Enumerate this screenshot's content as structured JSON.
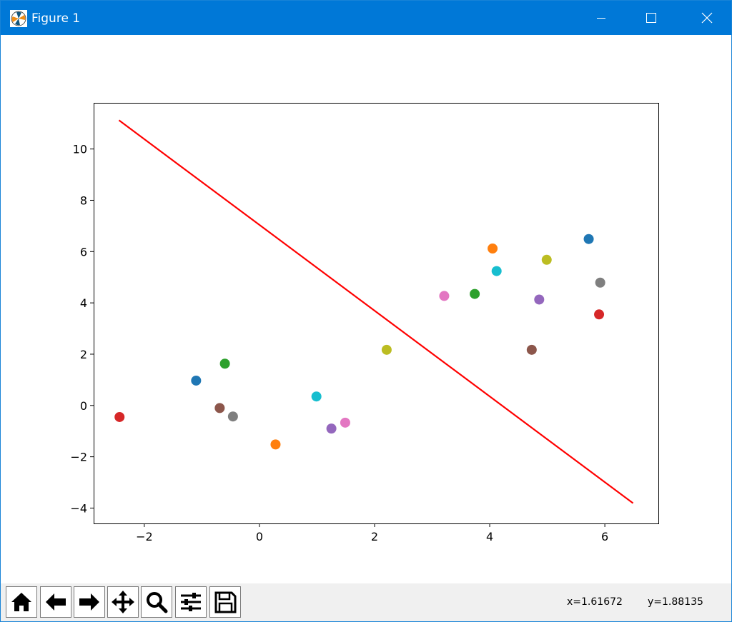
{
  "window": {
    "title": "Figure 1"
  },
  "colors": {
    "titlebar": "#0078d7",
    "line": "#ff0000",
    "toolbar": "#f0f0f0"
  },
  "toolbar": {
    "buttons": [
      {
        "name": "home-icon"
      },
      {
        "name": "back-arrow-icon"
      },
      {
        "name": "forward-arrow-icon"
      },
      {
        "name": "pan-icon"
      },
      {
        "name": "zoom-icon"
      },
      {
        "name": "configure-subplots-icon"
      },
      {
        "name": "save-icon"
      }
    ],
    "x_readout": "x=1.61672",
    "y_readout": "y=1.88135"
  },
  "chart_data": {
    "type": "scatter",
    "title": "",
    "xlabel": "",
    "ylabel": "",
    "xlim": [
      -2.88,
      6.93
    ],
    "ylim": [
      -4.6,
      11.8
    ],
    "xticks": [
      -2,
      0,
      2,
      4,
      6
    ],
    "yticks": [
      -4,
      -2,
      0,
      2,
      4,
      6,
      8,
      10
    ],
    "x_tick_labels": [
      "−2",
      "0",
      "2",
      "4",
      "6"
    ],
    "y_tick_labels": [
      "−4",
      "−2",
      "0",
      "2",
      "4",
      "6",
      "8",
      "10"
    ],
    "grid": false,
    "line": {
      "color": "#ff0000",
      "x": [
        -2.44,
        6.49
      ],
      "y": [
        11.12,
        -3.81
      ]
    },
    "points": [
      {
        "x": -1.1,
        "y": 0.97,
        "color": "#1f77b4"
      },
      {
        "x": 0.28,
        "y": -1.52,
        "color": "#ff7f0e"
      },
      {
        "x": -0.6,
        "y": 1.63,
        "color": "#2ca02c"
      },
      {
        "x": -2.43,
        "y": -0.45,
        "color": "#d62728"
      },
      {
        "x": 1.25,
        "y": -0.9,
        "color": "#9467bd"
      },
      {
        "x": -0.69,
        "y": -0.1,
        "color": "#8c564b"
      },
      {
        "x": 1.49,
        "y": -0.67,
        "color": "#e377c2"
      },
      {
        "x": -0.46,
        "y": -0.43,
        "color": "#7f7f7f"
      },
      {
        "x": 2.21,
        "y": 2.17,
        "color": "#bcbd22"
      },
      {
        "x": 0.99,
        "y": 0.35,
        "color": "#17becf"
      },
      {
        "x": 5.72,
        "y": 6.49,
        "color": "#1f77b4"
      },
      {
        "x": 4.05,
        "y": 6.12,
        "color": "#ff7f0e"
      },
      {
        "x": 3.74,
        "y": 4.35,
        "color": "#2ca02c"
      },
      {
        "x": 5.9,
        "y": 3.55,
        "color": "#d62728"
      },
      {
        "x": 4.86,
        "y": 4.13,
        "color": "#9467bd"
      },
      {
        "x": 4.73,
        "y": 2.17,
        "color": "#8c564b"
      },
      {
        "x": 3.21,
        "y": 4.27,
        "color": "#e377c2"
      },
      {
        "x": 5.92,
        "y": 4.79,
        "color": "#7f7f7f"
      },
      {
        "x": 4.99,
        "y": 5.68,
        "color": "#bcbd22"
      },
      {
        "x": 4.12,
        "y": 5.24,
        "color": "#17becf"
      }
    ]
  }
}
